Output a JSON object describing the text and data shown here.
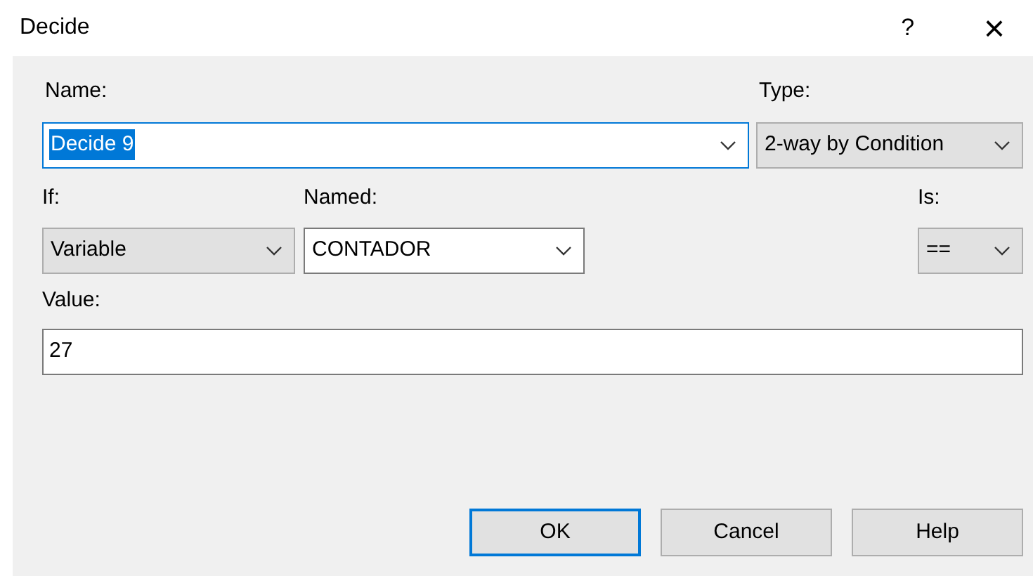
{
  "window": {
    "title": "Decide",
    "help": "?",
    "close": "×"
  },
  "name": {
    "label": "Name:",
    "value": "Decide 9",
    "focused": true,
    "text_selected": true
  },
  "type": {
    "label": "Type:",
    "value": "2-way by Condition"
  },
  "if": {
    "label": "If:",
    "value": "Variable"
  },
  "named": {
    "label": "Named:",
    "value": "CONTADOR"
  },
  "is": {
    "label": "Is:",
    "value": "=="
  },
  "value": {
    "label": "Value:",
    "value": "27"
  },
  "buttons": [
    {
      "label": "OK",
      "default": true
    },
    {
      "label": "Cancel",
      "default": false
    },
    {
      "label": "Help",
      "default": false
    }
  ]
}
